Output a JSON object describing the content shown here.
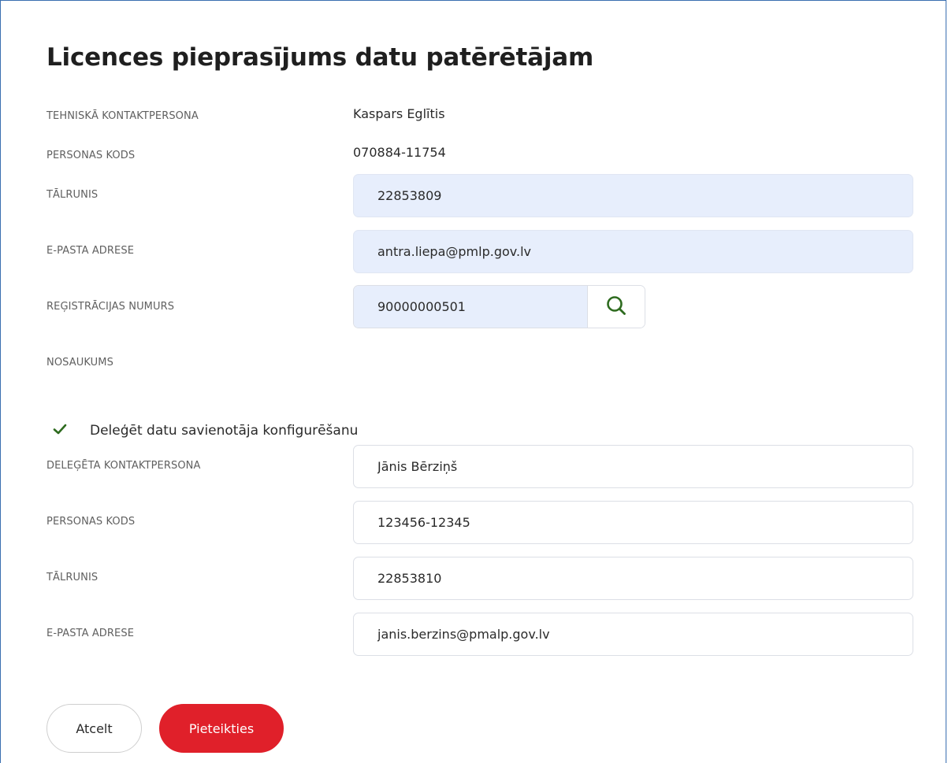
{
  "form": {
    "title": "Licences pieprasījums datu patērētājam",
    "technical_contact": {
      "label": "TEHNISKĀ KONTAKTPERSONA",
      "value": "Kaspars Eglītis"
    },
    "personal_code": {
      "label": "PERSONAS KODS",
      "value": "070884-11754"
    },
    "phone": {
      "label": "TĀLRUNIS",
      "value": "22853809"
    },
    "email": {
      "label": "E-PASTA ADRESE",
      "value": "antra.liepa@pmlp.gov.lv"
    },
    "registration_number": {
      "label": "REĢISTRĀCIJAS NUMURS",
      "value": "90000000501"
    },
    "name": {
      "label": "NOSAUKUMS",
      "value": ""
    },
    "delegate_checkbox": {
      "label": "Deleģēt datu savienotāja konfigurēšanu",
      "checked": true
    },
    "delegated_contact": {
      "label": "DELEĢĒTA KONTAKTPERSONA",
      "value": "Jānis Bērziņš"
    },
    "delegated_personal_code": {
      "label": "PERSONAS KODS",
      "value": "123456-12345"
    },
    "delegated_phone": {
      "label": "TĀLRUNIS",
      "value": "22853810"
    },
    "delegated_email": {
      "label": "E-PASTA ADRESE",
      "value": "janis.berzins@pmalp.gov.lv"
    }
  },
  "buttons": {
    "cancel": "Atcelt",
    "submit": "Pieteikties"
  },
  "icons": {
    "search": "search-icon",
    "check": "check-icon"
  },
  "colors": {
    "accent_red": "#e0202a",
    "icon_green": "#2e6b1f",
    "filled_input_bg": "#e7eefc",
    "frame_border": "#3a6fb0"
  }
}
